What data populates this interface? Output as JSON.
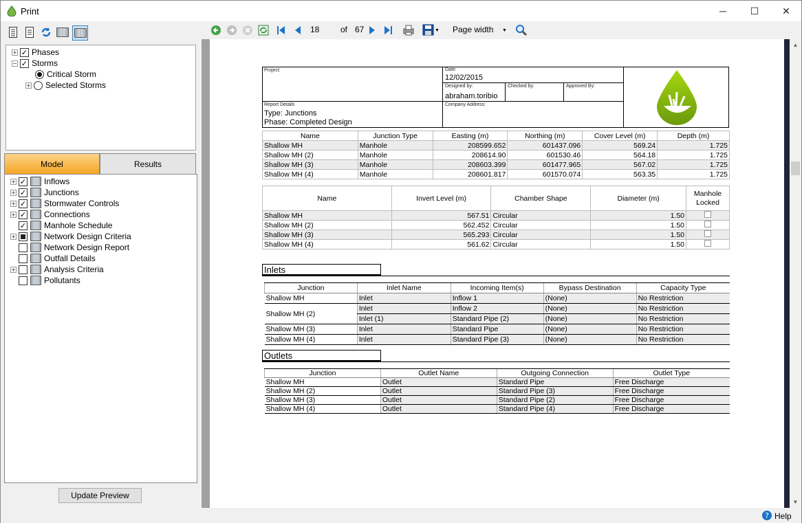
{
  "window": {
    "title": "Print",
    "minimize": "─",
    "maximize": "☐",
    "close": "✕"
  },
  "phasesTree": {
    "phases": "Phases",
    "storms": "Storms",
    "critical": "Critical Storm",
    "selected": "Selected Storms"
  },
  "tabs": {
    "model": "Model",
    "results": "Results"
  },
  "modelTree": {
    "items": [
      "Inflows",
      "Junctions",
      "Stormwater Controls",
      "Connections",
      "Manhole Schedule",
      "Network Design Criteria",
      "Network Design Report",
      "Outfall Details",
      "Analysis Criteria",
      "Pollutants"
    ]
  },
  "updatePreview": "Update Preview",
  "toolbar": {
    "page": "18",
    "of": "of",
    "total": "67",
    "zoom": "Page width"
  },
  "help": "Help",
  "colors": {
    "tabActive": "#f5a623",
    "accent": "#2e7d32",
    "pageBar": "#202438"
  },
  "report": {
    "projectLabel": "Project:",
    "dateLabel": "Date:",
    "date": "12/02/2015",
    "designedLabel": "Designed by:",
    "designed": "abraham.toribio",
    "checkedLabel": "Checked by:",
    "approvedLabel": "Approved By:",
    "detailsLabel": "Report Details",
    "type": "Type: Junctions",
    "phase": "Phase: Completed Design",
    "companyLabel": "Company Address:",
    "t1": {
      "headers": [
        "Name",
        "Junction Type",
        "Easting (m)",
        "Northing (m)",
        "Cover Level (m)",
        "Depth (m)"
      ],
      "rows": [
        [
          "Shallow MH",
          "Manhole",
          "208599.652",
          "601437.096",
          "569.24",
          "1.725"
        ],
        [
          "Shallow MH (2)",
          "Manhole",
          "208614.90",
          "601530.46",
          "564.18",
          "1.725"
        ],
        [
          "Shallow MH (3)",
          "Manhole",
          "208603.399",
          "601477.965",
          "567.02",
          "1.725"
        ],
        [
          "Shallow MH (4)",
          "Manhole",
          "208601.817",
          "601570.074",
          "563.35",
          "1.725"
        ]
      ]
    },
    "t2": {
      "headers": [
        "Name",
        "Invert Level (m)",
        "Chamber Shape",
        "Diameter (m)",
        "Manhole Locked"
      ],
      "rows": [
        [
          "Shallow MH",
          "567.51",
          "Circular",
          "1.50"
        ],
        [
          "Shallow MH (2)",
          "562.452",
          "Circular",
          "1.50"
        ],
        [
          "Shallow MH (3)",
          "565.293",
          "Circular",
          "1.50"
        ],
        [
          "Shallow MH (4)",
          "561.62",
          "Circular",
          "1.50"
        ]
      ]
    },
    "inletsTitle": "Inlets",
    "inlets": {
      "headers": [
        "Junction",
        "Inlet Name",
        "Incoming Item(s)",
        "Bypass Destination",
        "Capacity Type"
      ],
      "rows": [
        [
          "Shallow MH",
          "Inlet",
          "Inflow 1",
          "(None)",
          "No Restriction"
        ],
        [
          "Shallow MH (2)",
          "Inlet",
          "Inflow 2",
          "(None)",
          "No Restriction"
        ],
        [
          "",
          "Inlet (1)",
          "Standard Pipe (2)",
          "(None)",
          "No Restriction"
        ],
        [
          "Shallow MH (3)",
          "Inlet",
          "Standard Pipe",
          "(None)",
          "No Restriction"
        ],
        [
          "Shallow MH (4)",
          "Inlet",
          "Standard Pipe (3)",
          "(None)",
          "No Restriction"
        ]
      ]
    },
    "outletsTitle": "Outlets",
    "outlets": {
      "headers": [
        "Junction",
        "Outlet Name",
        "Outgoing Connection",
        "Outlet Type"
      ],
      "rows": [
        [
          "Shallow MH",
          "Outlet",
          "Standard Pipe",
          "Free Discharge"
        ],
        [
          "Shallow MH (2)",
          "Outlet",
          "Standard Pipe (3)",
          "Free Discharge"
        ],
        [
          "Shallow MH (3)",
          "Outlet",
          "Standard Pipe (2)",
          "Free Discharge"
        ],
        [
          "Shallow MH (4)",
          "Outlet",
          "Standard Pipe (4)",
          "Free Discharge"
        ]
      ]
    }
  }
}
